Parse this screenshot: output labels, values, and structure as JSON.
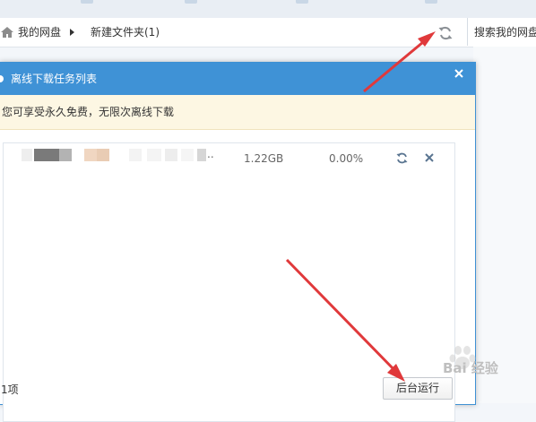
{
  "breadcrumb": {
    "root": "我的网盘",
    "folder": "新建文件夹(1)"
  },
  "search": {
    "placeholder": "搜索我的网盘"
  },
  "dialog": {
    "title": "离线下载任务列表",
    "notice": "您可享受永久免费，无限次离线下载",
    "tasks": [
      {
        "name": "..",
        "size": "1.22GB",
        "progress": "0.00%"
      }
    ],
    "count": "1项",
    "background_button": "后台运行"
  },
  "watermark": {
    "text": "Bai 经验"
  },
  "colors": {
    "title_bar": "#3f92d6",
    "notice_bg": "#fdf7e3",
    "arrow": "#e0393b"
  }
}
